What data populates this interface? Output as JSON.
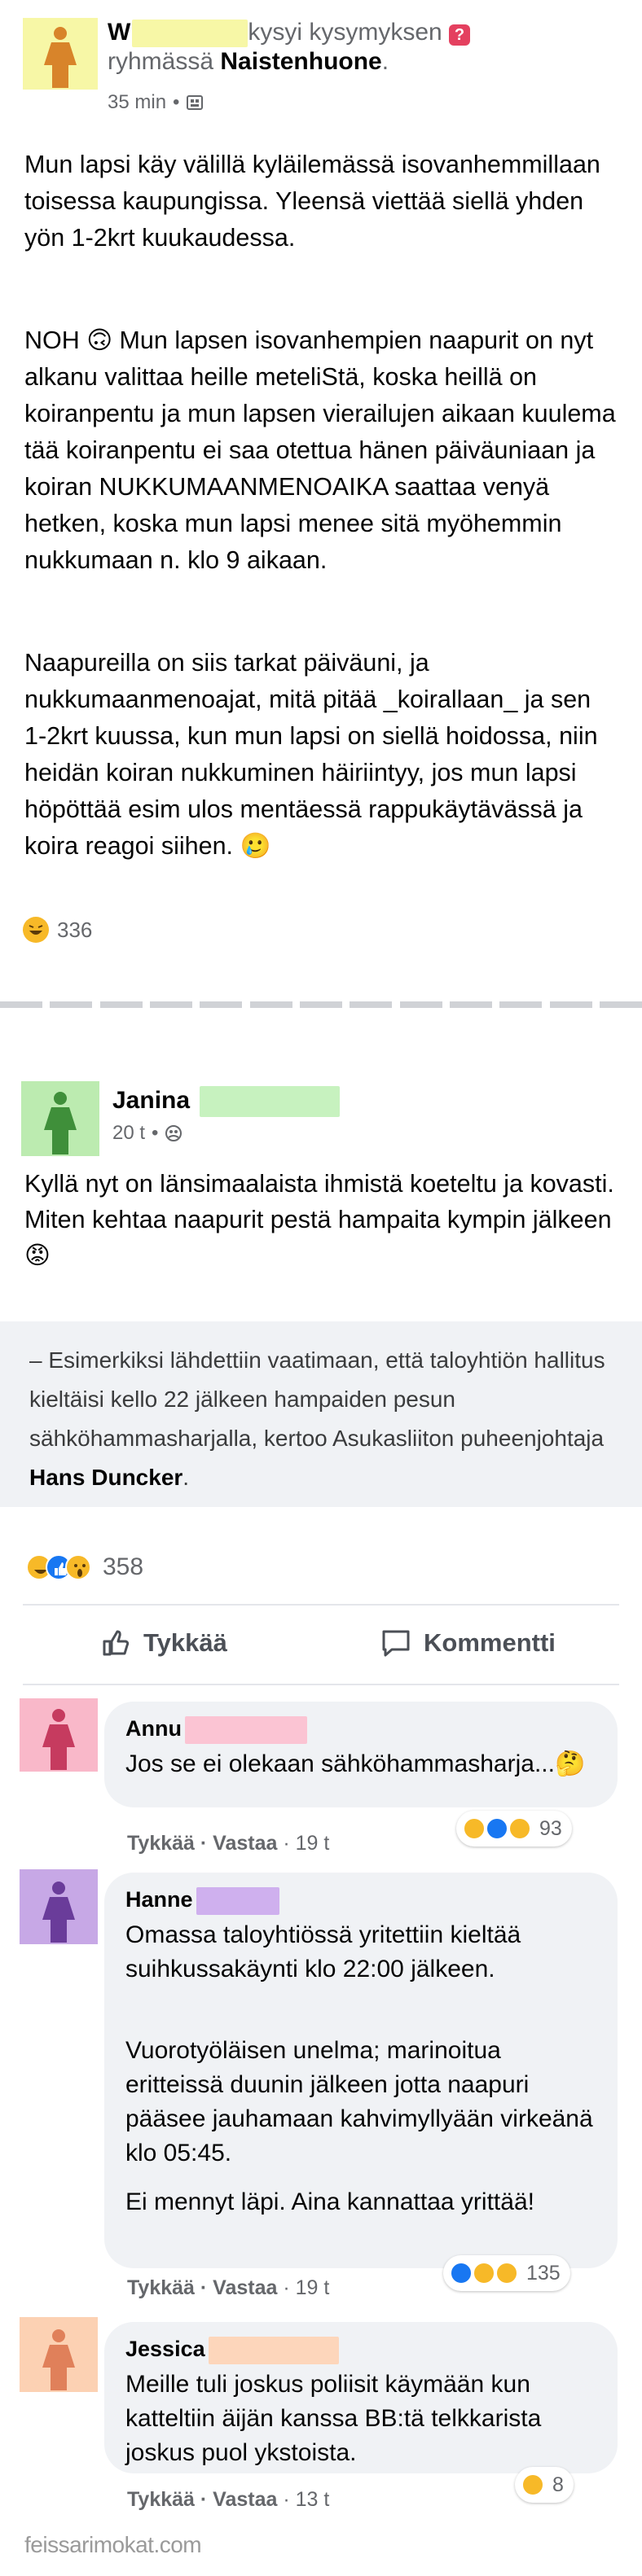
{
  "post": {
    "author_initial": "W",
    "asked_text": "kysyi kysymyksen",
    "in_group_prefix": "ryhmässä",
    "group_name": "Naistenhuone",
    "group_suffix": ".",
    "time": "35 min",
    "dot": "•",
    "paragraph_1": "Mun lapsi käy välillä kyläilemässä isovanhemmillaan toisessa kaupungissa. Yleensä viettää siellä yhden yön 1-2krt kuukaudessa.",
    "paragraph_2": "NOH 🙃 Mun lapsen isovanhempien naapurit on nyt alkanu valittaa heille meteliStä, koska heillä on koiranpentu ja mun lapsen vierailujen aikaan kuulema tää koiranpentu ei saa otettua hänen päiväuniaan ja koiran NUKKUMAANMENOAIKA saattaa venyä hetken, koska mun lapsi menee sitä myöhemmin nukkumaan n. klo 9 aikaan.",
    "paragraph_3": "Naapureilla on siis tarkat päiväuni, ja nukkumaanmenoajat, mitä pitää _koirallaan_ ja sen 1-2krt kuussa, kun mun lapsi on siellä hoidossa, niin heidän koiran nukkuminen häiriintyy, jos mun lapsi höpöttää esim ulos mentäessä rappukäytävässä ja koira reagoi siihen. 🥲",
    "reaction_count": "336"
  },
  "post2": {
    "author": "Janina",
    "time": "20 t",
    "dot": "•",
    "text": "Kyllä nyt on länsimaalaista ihmistä koeteltu ja kovasti.\nMiten kehtaa naapurit pestä hampaita kympin jälkeen😡",
    "quote_text": "– Esimerkiksi lähdettiin vaatimaan, että taloyhtiön hallitus kieltäisi kello 22 jälkeen hampaiden pesun sähköhammasharjalla, kertoo Asukasliiton puheenjohtaja ",
    "quote_bold": "Hans Duncker",
    "quote_end": ".",
    "reaction_count": "358",
    "like_label": "Tykkää",
    "comment_label": "Kommentti"
  },
  "comments": [
    {
      "name": "Annu",
      "text": "Jos se ei olekaan sähköhammasharja...🤔",
      "like": "Tykkää",
      "reply": "Vastaa",
      "sep": "·",
      "time": "19 t",
      "reaction_count": "93"
    },
    {
      "name": "Hanne",
      "text_1": "Omassa taloyhtiössä yritettiin kieltää suihkussakäynti klo 22:00 jälkeen.",
      "text_2": "Vuorotyöläisen unelma; marinoitua eritteissä duunin jälkeen jotta naapuri pääsee jauhamaan kahvimyllyään virkeänä klo 05:45.",
      "text_3": "Ei mennyt läpi. Aina kannattaa yrittää!",
      "like": "Tykkää",
      "reply": "Vastaa",
      "sep": "·",
      "time": "19 t",
      "reaction_count": "135"
    },
    {
      "name": "Jessica",
      "text": "Meille tuli joskus poliisit käymään kun katteltiin äijän kanssa BB:tä telkkarista joskus puol ykstoista.",
      "like": "Tykkää",
      "reply": "Vastaa",
      "sep": "·",
      "time": "13 t",
      "reaction_count": "8"
    }
  ],
  "watermark": "feissarimokat.com",
  "colors": {
    "avatar_yellow": "#f7f7a6",
    "avatar_green": "#bcebb0",
    "avatar_pink": "#f9b8c9",
    "avatar_purple": "#c7a8e6",
    "avatar_peach": "#fcd1b3",
    "like_blue": "#1877f2",
    "haha_yellow": "#f7b928",
    "question_red": "#e4405f"
  }
}
